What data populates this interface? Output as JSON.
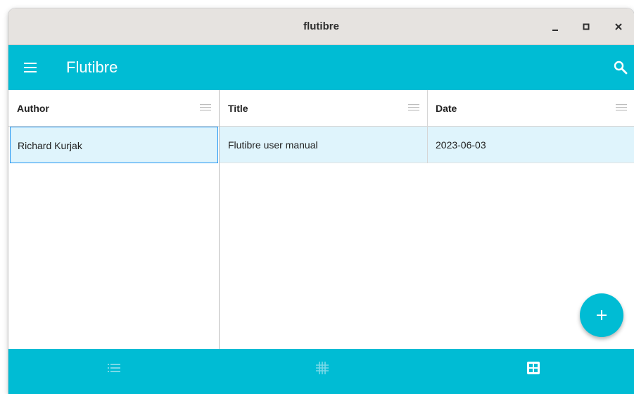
{
  "window": {
    "title": "flutibre"
  },
  "appbar": {
    "title": "Flutibre",
    "menu_icon": "menu-icon",
    "search_icon": "search-icon"
  },
  "authors_table": {
    "header": "Author",
    "rows": [
      {
        "author": "Richard Kurjak",
        "selected": true
      }
    ]
  },
  "books_table": {
    "headers": {
      "title": "Title",
      "date": "Date"
    },
    "rows": [
      {
        "title": "Flutibre user manual",
        "date": "2023-06-03",
        "selected": true
      }
    ]
  },
  "fab": {
    "icon": "add-icon"
  },
  "bottom_nav": [
    {
      "icon": "list-icon",
      "active": false
    },
    {
      "icon": "grid-icon",
      "active": false
    },
    {
      "icon": "table-view-icon",
      "active": true
    }
  ],
  "colors": {
    "accent": "#00bcd4",
    "selected_row": "#dff4fc",
    "selected_border": "#2196f3"
  }
}
